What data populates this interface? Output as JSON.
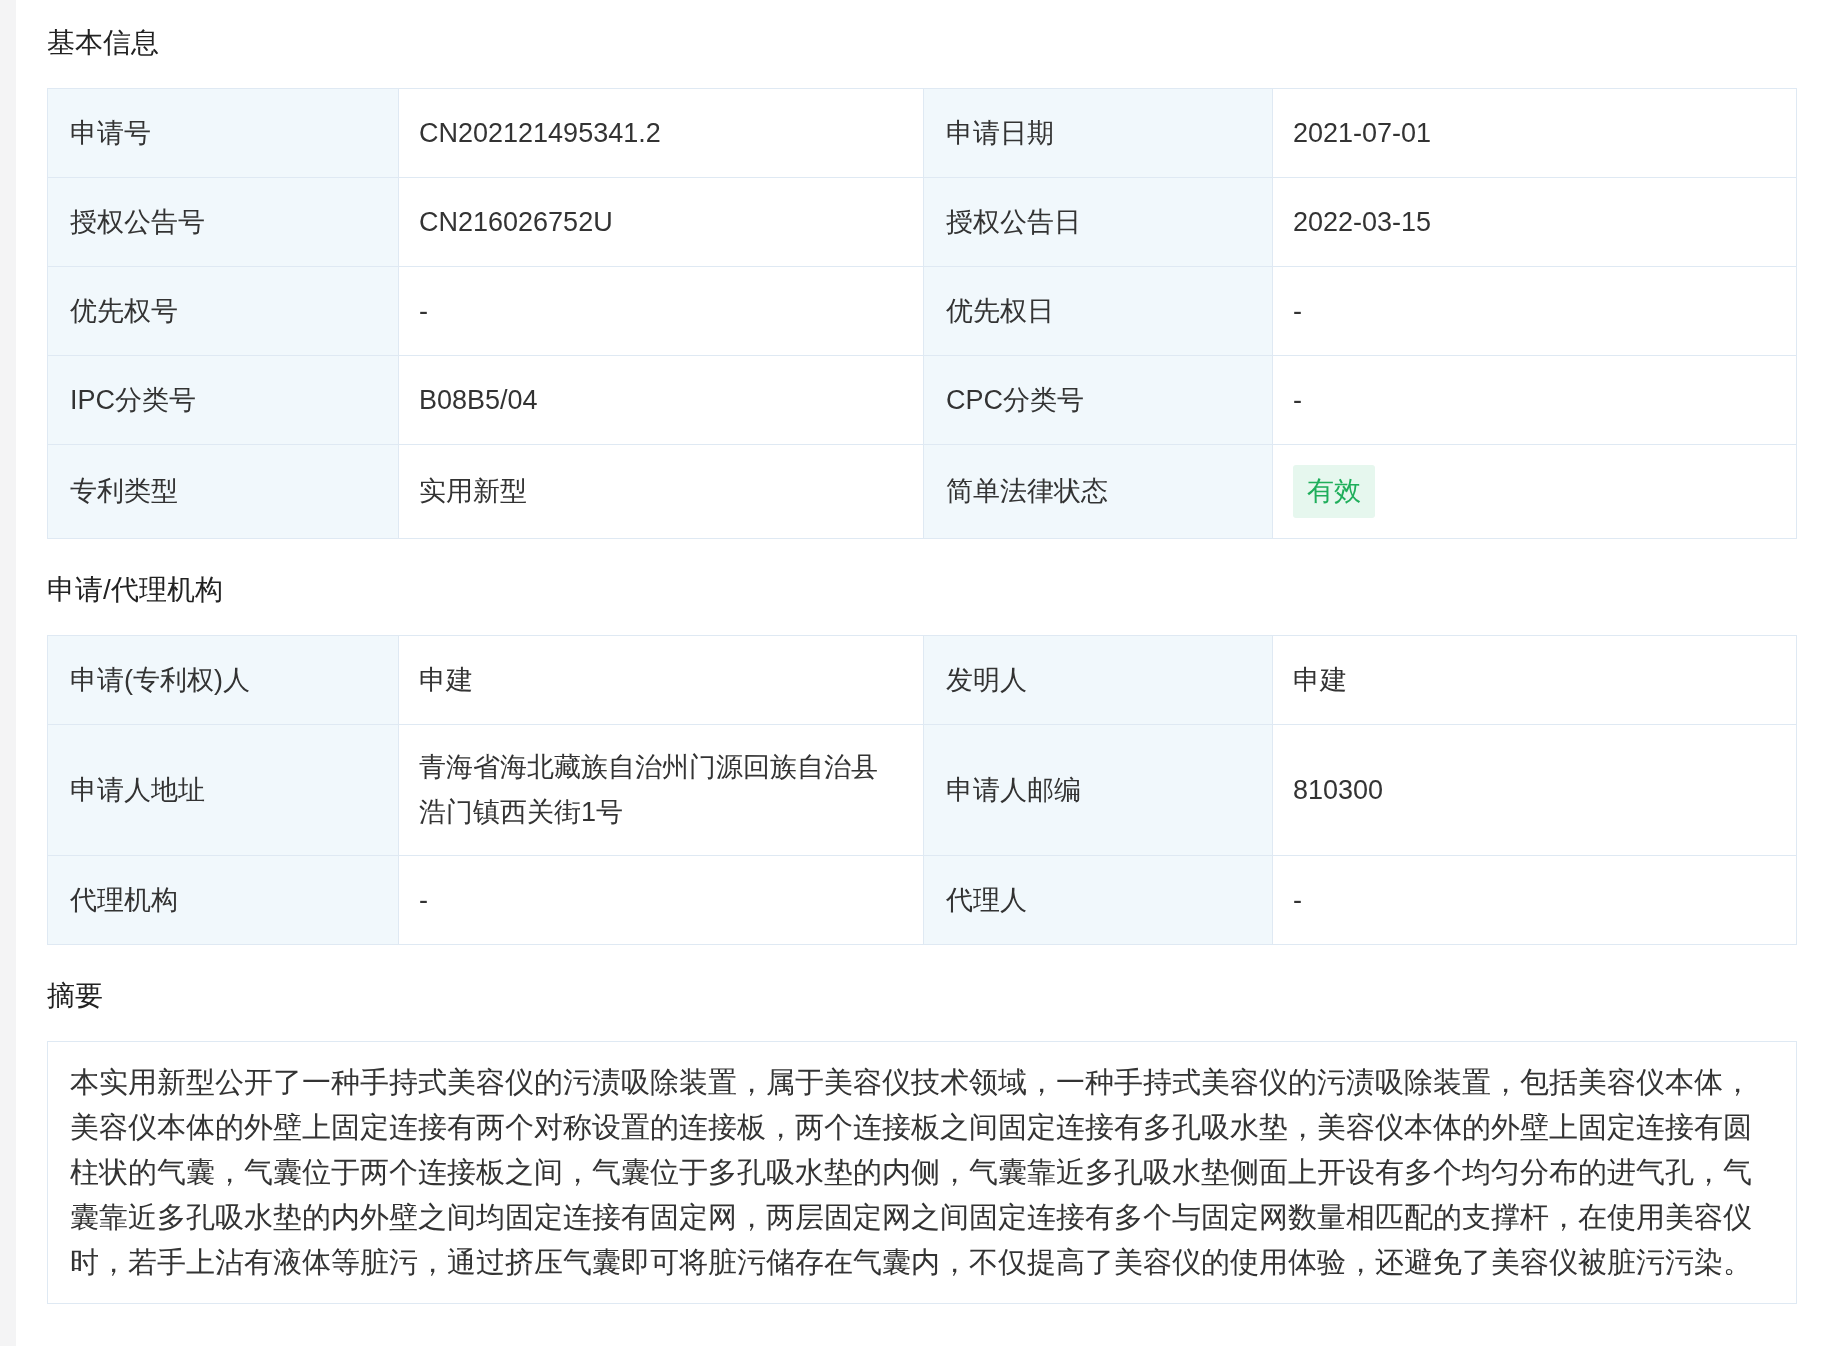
{
  "sections": [
    {
      "kind": "table",
      "title": "基本信息",
      "rows": [
        [
          {
            "label": "申请号",
            "value": "CN202121495341.2",
            "kind": "text"
          },
          {
            "label": "申请日期",
            "value": "2021-07-01",
            "kind": "text"
          }
        ],
        [
          {
            "label": "授权公告号",
            "value": "CN216026752U",
            "kind": "text"
          },
          {
            "label": "授权公告日",
            "value": "2022-03-15",
            "kind": "text"
          }
        ],
        [
          {
            "label": "优先权号",
            "value": "-",
            "kind": "text"
          },
          {
            "label": "优先权日",
            "value": "-",
            "kind": "text"
          }
        ],
        [
          {
            "label": "IPC分类号",
            "value": "B08B5/04",
            "kind": "text"
          },
          {
            "label": "CPC分类号",
            "value": "-",
            "kind": "text"
          }
        ],
        [
          {
            "label": "专利类型",
            "value": "实用新型",
            "kind": "text"
          },
          {
            "label": "简单法律状态",
            "value": "有效",
            "kind": "badge"
          }
        ]
      ]
    },
    {
      "kind": "table",
      "title": "申请/代理机构",
      "rows": [
        [
          {
            "label": "申请(专利权)人",
            "value": "申建",
            "kind": "text"
          },
          {
            "label": "发明人",
            "value": "申建",
            "kind": "text"
          }
        ],
        [
          {
            "label": "申请人地址",
            "value": "青海省海北藏族自治州门源回族自治县浩门镇西关街1号",
            "kind": "text"
          },
          {
            "label": "申请人邮编",
            "value": "810300",
            "kind": "text"
          }
        ],
        [
          {
            "label": "代理机构",
            "value": "-",
            "kind": "text"
          },
          {
            "label": "代理人",
            "value": "-",
            "kind": "text"
          }
        ]
      ]
    },
    {
      "kind": "text",
      "title": "摘要",
      "text": "本实用新型公开了一种手持式美容仪的污渍吸除装置，属于美容仪技术领域，一种手持式美容仪的污渍吸除装置，包括美容仪本体，美容仪本体的外壁上固定连接有两个对称设置的连接板，两个连接板之间固定连接有多孔吸水垫，美容仪本体的外壁上固定连接有圆柱状的气囊，气囊位于两个连接板之间，气囊位于多孔吸水垫的内侧，气囊靠近多孔吸水垫侧面上开设有多个均匀分布的进气孔，气囊靠近多孔吸水垫的内外壁之间均固定连接有固定网，两层固定网之间固定连接有多个与固定网数量相匹配的支撑杆，在使用美容仪时，若手上沾有液体等脏污，通过挤压气囊即可将脏污储存在气囊内，不仅提高了美容仪的使用体验，还避免了美容仪被脏污污染。"
    }
  ]
}
